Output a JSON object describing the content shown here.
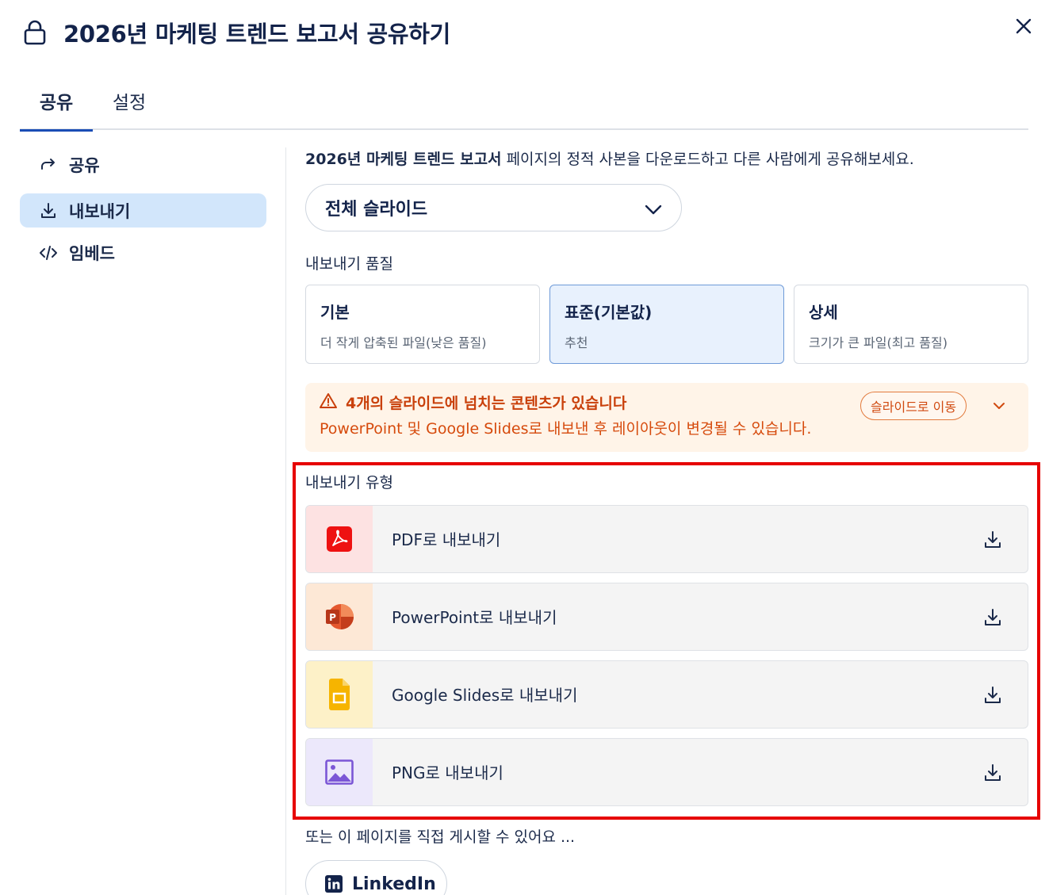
{
  "header": {
    "title": "2026년 마케팅 트렌드 보고서 공유하기",
    "lock_icon": "lock-icon",
    "close_icon": "close-icon"
  },
  "tabs": [
    {
      "label": "공유",
      "active": true
    },
    {
      "label": "설정",
      "active": false
    }
  ],
  "sidebar": {
    "items": [
      {
        "label": "공유",
        "icon": "share-arrow-icon",
        "active": false
      },
      {
        "label": "내보내기",
        "icon": "download-icon",
        "active": true
      },
      {
        "label": "임베드",
        "icon": "code-icon",
        "active": false
      }
    ]
  },
  "main": {
    "intro_bold": "2026년 마케팅 트렌드 보고서",
    "intro_rest": " 페이지의 정적 사본을 다운로드하고 다른 사람에게 공유해보세요.",
    "slides_select": "전체 슬라이드",
    "quality_label": "내보내기 품질",
    "quality_options": [
      {
        "title": "기본",
        "desc": "더 작게 압축된 파일(낮은 품질)",
        "selected": false
      },
      {
        "title": "표준(기본값)",
        "desc": "추천",
        "selected": true
      },
      {
        "title": "상세",
        "desc": "크기가 큰 파일(최고 품질)",
        "selected": false
      }
    ],
    "warning": {
      "title": "4개의 슬라이드에 넘치는 콘텐츠가 있습니다",
      "text": "PowerPoint 및 Google Slides로 내보낸 후 레이아웃이 변경될 수 있습니다.",
      "button": "슬라이드로 이동",
      "color": "#c9400b"
    },
    "export_type_label": "내보내기 유형",
    "exports": [
      {
        "label": "PDF로 내보내기",
        "icon": "pdf-icon",
        "lead_bg": "#fde2e2"
      },
      {
        "label": "PowerPoint로 내보내기",
        "icon": "powerpoint-icon",
        "lead_bg": "#fde8d6"
      },
      {
        "label": "Google Slides로 내보내기",
        "icon": "google-slides-icon",
        "lead_bg": "#fdf1c8"
      },
      {
        "label": "PNG로 내보내기",
        "icon": "image-icon",
        "lead_bg": "#ece8fb"
      }
    ],
    "alt_label": "또는 이 페이지를 직접 게시할 수 있어요 ...",
    "linkedin_label": "LinkedIn"
  },
  "colors": {
    "accent": "#1a4db5",
    "sidebar_active": "#d2e6fb",
    "highlight_box": "#e60000"
  }
}
